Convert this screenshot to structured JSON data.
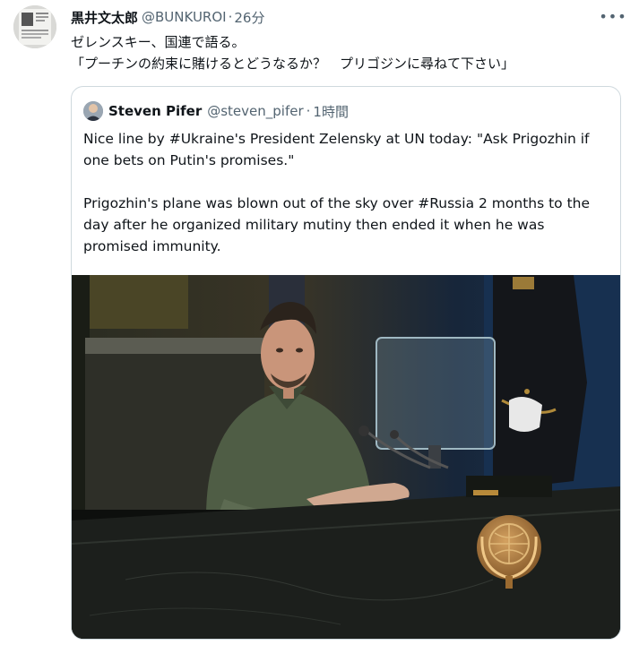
{
  "tweet": {
    "author": {
      "display_name": "黒井文太郎",
      "handle": "@BUNKUROI",
      "separator": "·",
      "time": "26分"
    },
    "text_lines": [
      "ゼレンスキー、国連で語る。",
      "「プーチンの約束に賭けるとどうなるか？　プリゴジンに尋ねて下さい」"
    ],
    "more_icon": "more-horizontal-icon"
  },
  "quoted_tweet": {
    "author": {
      "display_name": "Steven Pifer",
      "handle": "@steven_pifer",
      "separator": "·",
      "time": "1時間"
    },
    "paragraphs": [
      "Nice line by #Ukraine's President Zelensky at UN today:  \"Ask Prigozhin if one bets on Putin's promises.\"",
      "Prigozhin's plane was blown out of the sky over #Russia 2 months to the day after he organized military mutiny then ended it when he was promised immunity."
    ]
  },
  "colors": {
    "text_primary": "#0f1419",
    "text_secondary": "#536471",
    "border": "#cfd9de",
    "podium_marble": "#1c1f1c",
    "emblem_gold": "#a9753a",
    "sweater_green": "#4f5d45"
  }
}
